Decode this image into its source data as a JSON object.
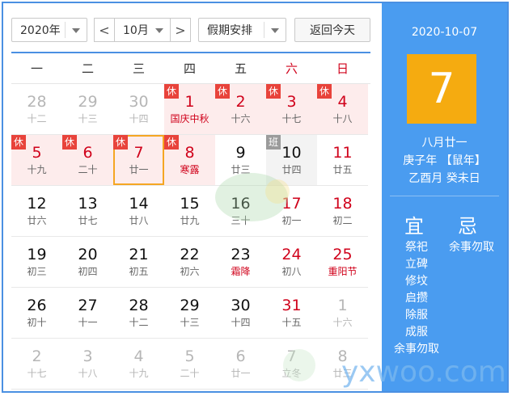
{
  "toolbar": {
    "year": "2020年",
    "month": "10月",
    "holiday": "假期安排",
    "today_btn": "返回今天",
    "prev": "<",
    "next": ">"
  },
  "weekdays": [
    "一",
    "二",
    "三",
    "四",
    "五",
    "六",
    "日"
  ],
  "days": [
    {
      "d": "28",
      "l": "十二",
      "s": "gray"
    },
    {
      "d": "29",
      "l": "十三",
      "s": "gray"
    },
    {
      "d": "30",
      "l": "十四",
      "s": "gray"
    },
    {
      "d": "1",
      "l": "国庆中秋",
      "s": "red",
      "bg": "hol",
      "badge": "休",
      "lred": true
    },
    {
      "d": "2",
      "l": "十六",
      "s": "red",
      "bg": "hol",
      "badge": "休"
    },
    {
      "d": "3",
      "l": "十七",
      "s": "red",
      "bg": "hol",
      "badge": "休"
    },
    {
      "d": "4",
      "l": "十八",
      "s": "red",
      "bg": "hol",
      "badge": "休"
    },
    {
      "d": "5",
      "l": "十九",
      "s": "red",
      "bg": "hol",
      "badge": "休"
    },
    {
      "d": "6",
      "l": "二十",
      "s": "red",
      "bg": "hol",
      "badge": "休"
    },
    {
      "d": "7",
      "l": "廿一",
      "s": "red",
      "bg": "hol",
      "badge": "休",
      "today": true
    },
    {
      "d": "8",
      "l": "寒露",
      "s": "red",
      "bg": "hol",
      "badge": "休",
      "lred": true
    },
    {
      "d": "9",
      "l": "廿三",
      "s": "normal"
    },
    {
      "d": "10",
      "l": "廿四",
      "s": "normal",
      "bg": "wk",
      "badge": "班",
      "work": true
    },
    {
      "d": "11",
      "l": "廿五",
      "s": "red"
    },
    {
      "d": "12",
      "l": "廿六",
      "s": "normal"
    },
    {
      "d": "13",
      "l": "廿七",
      "s": "normal"
    },
    {
      "d": "14",
      "l": "廿八",
      "s": "normal"
    },
    {
      "d": "15",
      "l": "廿九",
      "s": "normal"
    },
    {
      "d": "16",
      "l": "三十",
      "s": "normal"
    },
    {
      "d": "17",
      "l": "初一",
      "s": "red"
    },
    {
      "d": "18",
      "l": "初二",
      "s": "red"
    },
    {
      "d": "19",
      "l": "初三",
      "s": "normal"
    },
    {
      "d": "20",
      "l": "初四",
      "s": "normal"
    },
    {
      "d": "21",
      "l": "初五",
      "s": "normal"
    },
    {
      "d": "22",
      "l": "初六",
      "s": "normal"
    },
    {
      "d": "23",
      "l": "霜降",
      "s": "normal",
      "lred": true
    },
    {
      "d": "24",
      "l": "初八",
      "s": "red"
    },
    {
      "d": "25",
      "l": "重阳节",
      "s": "red",
      "lred": true
    },
    {
      "d": "26",
      "l": "初十",
      "s": "normal"
    },
    {
      "d": "27",
      "l": "十一",
      "s": "normal"
    },
    {
      "d": "28",
      "l": "十二",
      "s": "normal"
    },
    {
      "d": "29",
      "l": "十三",
      "s": "normal"
    },
    {
      "d": "30",
      "l": "十四",
      "s": "normal"
    },
    {
      "d": "31",
      "l": "十五",
      "s": "red"
    },
    {
      "d": "1",
      "l": "十六",
      "s": "gray"
    },
    {
      "d": "2",
      "l": "十七",
      "s": "gray"
    },
    {
      "d": "3",
      "l": "十八",
      "s": "gray"
    },
    {
      "d": "4",
      "l": "十九",
      "s": "gray"
    },
    {
      "d": "5",
      "l": "二十",
      "s": "gray"
    },
    {
      "d": "6",
      "l": "廿一",
      "s": "gray"
    },
    {
      "d": "7",
      "l": "立冬",
      "s": "gray"
    },
    {
      "d": "8",
      "l": "廿三",
      "s": "gray"
    }
  ],
  "side": {
    "date": "2020-10-07",
    "day": "7",
    "lunar": "八月廿一",
    "ganzhi_year": "庚子年 【鼠年】",
    "ganzhi_month_day": "乙酉月 癸未日",
    "yi_title": "宜",
    "ji_title": "忌",
    "yi": [
      "祭祀",
      "立碑",
      "修坟",
      "启攒",
      "除服",
      "成服",
      "余事勿取"
    ],
    "ji": [
      "余事勿取"
    ]
  },
  "watermark": "yxwoo.com",
  "colors": {
    "accent": "#4a9cf0",
    "holiday_red": "#d0021b",
    "today_box": "#f5ab10",
    "holiday_bg": "#fdecec"
  }
}
